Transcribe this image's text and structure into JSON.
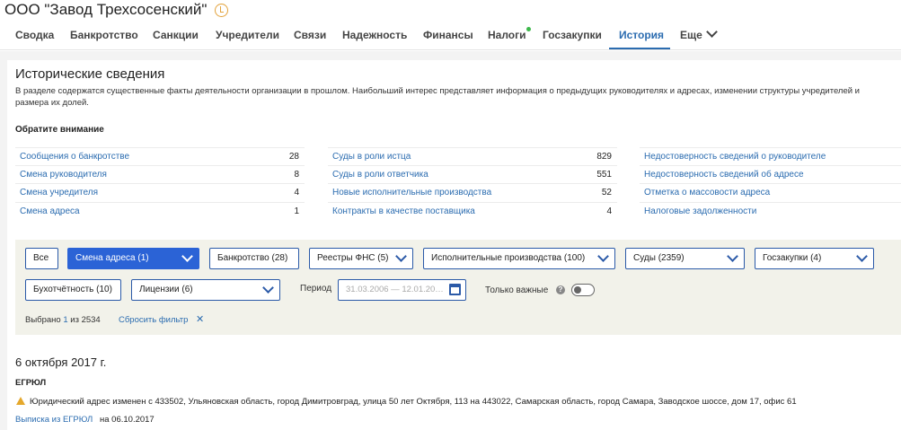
{
  "company": {
    "name": "ООО \"Завод Трехсосенский\""
  },
  "tabs": [
    {
      "label": "Сводка"
    },
    {
      "label": "Банкротство"
    },
    {
      "label": "Санкции"
    },
    {
      "label": "Учредители"
    },
    {
      "label": "Связи"
    },
    {
      "label": "Надежность"
    },
    {
      "label": "Финансы"
    },
    {
      "label": "Налоги"
    },
    {
      "label": "Госзакупки"
    },
    {
      "label": "История"
    },
    {
      "label": "Еще"
    }
  ],
  "active_tab": "История",
  "section": {
    "title": "Исторические сведения",
    "description": "В разделе содержатся существенные факты деятельности организации в прошлом. Наибольший интерес представляет информация о предыдущих руководителях и адресах, изменении структуры учредителей и размера их долей.",
    "attention_heading": "Обратите внимание"
  },
  "stats": {
    "col1": [
      {
        "label": "Сообщения о банкротстве",
        "count": "28"
      },
      {
        "label": "Смена руководителя",
        "count": "8"
      },
      {
        "label": "Смена учредителя",
        "count": "4"
      },
      {
        "label": "Смена адреса",
        "count": "1"
      }
    ],
    "col2": [
      {
        "label": "Суды в роли истца",
        "count": "829"
      },
      {
        "label": "Суды в роли ответчика",
        "count": "551"
      },
      {
        "label": "Новые исполнительные производства",
        "count": "52"
      },
      {
        "label": "Контракты в качестве поставщика",
        "count": "4"
      }
    ],
    "col3": [
      {
        "label": "Недостоверность сведений о руководителе"
      },
      {
        "label": "Недостоверность сведений об адресе"
      },
      {
        "label": "Отметка о массовости адреса"
      },
      {
        "label": "Налоговые задолженности"
      }
    ]
  },
  "filters": {
    "all": "Все",
    "address_change": "Смена адреса (1)",
    "bankruptcy": "Банкротство (28)",
    "fns_registry": "Реестры ФНС (5)",
    "enforcement": "Исполнительные производства (100)",
    "courts": "Суды (2359)",
    "procurement": "Госзакупки (4)",
    "accounting": "Бухотчётность (10)",
    "licenses": "Лицензии (6)",
    "period_label": "Период",
    "period_value": "31.03.2006 — 12.01.20…",
    "important_only": "Только важные",
    "selected_prefix": "Выбрано",
    "selected_count": "1",
    "selected_suffix": "из 2534",
    "reset": "Сбросить фильтр"
  },
  "event": {
    "date": "6 октября 2017 г.",
    "source": "ЕГРЮЛ",
    "text": "Юридический адрес изменен с 433502, Ульяновская область, город Димитровград, улица 50 лет Октября, 113 на 443022, Самарская область, город Самара, Заводское шоссе, дом 17, офис 61",
    "extract_link": "Выписка из ЕГРЮЛ",
    "extract_suffix": "на 06.10.2017"
  },
  "colors": {
    "accent": "#2b6cb0",
    "selected_filter": "#2b63d6",
    "panel_bg": "#f2f2ea",
    "warning": "#e5a82c",
    "notification_dot": "#3cb84a"
  }
}
